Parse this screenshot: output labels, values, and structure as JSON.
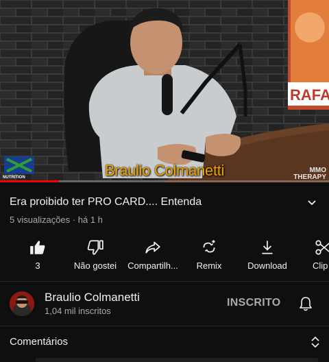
{
  "video": {
    "caption": "Braulio Colmanetti",
    "watermark_left": "NUTRITION",
    "watermark_right_line1": "MMO",
    "watermark_right_line2": "THERAPY",
    "poster_text": "RAFAE",
    "progress_fraction": 0.18
  },
  "details": {
    "title": "Era proibido ter PRO CARD.... Entenda",
    "views": "5 visualizações",
    "separator": "·",
    "age": "há 1 h"
  },
  "actions": [
    {
      "icon": "thumbs-up-filled-icon",
      "label": "3"
    },
    {
      "icon": "thumbs-down-icon",
      "label": "Não gostei"
    },
    {
      "icon": "share-icon",
      "label": "Compartilh..."
    },
    {
      "icon": "remix-icon",
      "label": "Remix"
    },
    {
      "icon": "download-icon",
      "label": "Download"
    },
    {
      "icon": "scissors-icon",
      "label": "Clip"
    }
  ],
  "channel": {
    "name": "Braulio Colmanetti",
    "subscribers": "1,04 mil inscritos",
    "subscribe_state": "INSCRITO"
  },
  "comments": {
    "label": "Comentários"
  },
  "colors": {
    "background": "#0f0f0f",
    "caption": "#f0a400",
    "progress": "#ff0000",
    "secondary_text": "#aaaaaa"
  }
}
